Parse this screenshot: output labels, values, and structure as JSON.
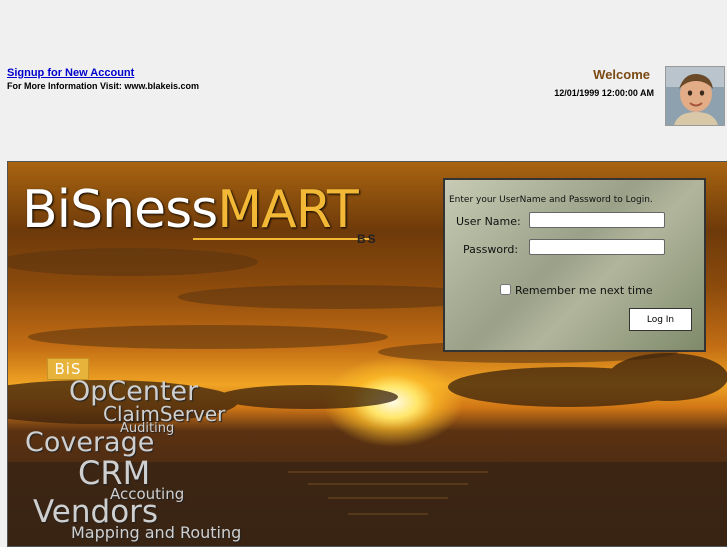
{
  "header": {
    "signup_link": "Signup for New Account",
    "more_info": "For More Information Visit: www.blakeis.com",
    "welcome": "Welcome",
    "datetime": "12/01/1999 12:00:00 AM"
  },
  "logo": {
    "part1": "BiSness",
    "part2": "MART",
    "sub": "BS"
  },
  "login": {
    "prompt": "Enter your UserName and Password to Login.",
    "username_label": "User Name:",
    "username_value": "",
    "password_label": "Password:",
    "password_value": "",
    "remember_label": "Remember me next time",
    "remember_checked": false,
    "login_button": "Log In"
  },
  "products": {
    "badge": "BiS",
    "items": [
      "OpCenter",
      "ClaimServer",
      "Auditing",
      "Coverage",
      "CRM",
      "Accouting",
      "Vendors",
      "Mapping and Routing"
    ]
  },
  "colors": {
    "link": "#0000cc",
    "welcome": "#7a4a12",
    "brand_gold": "#f3b936"
  }
}
